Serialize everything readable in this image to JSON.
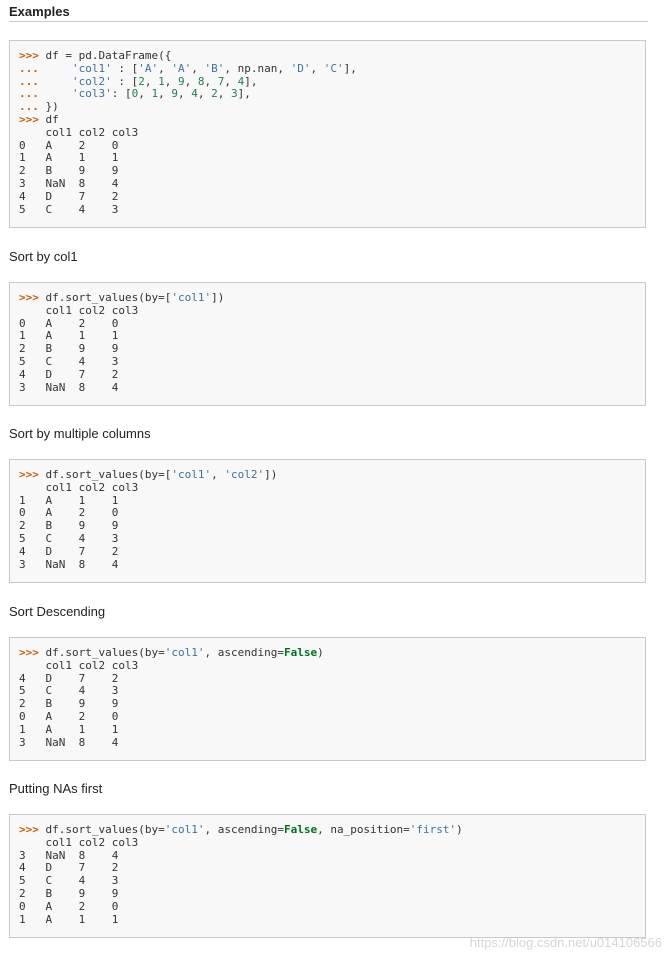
{
  "page": {
    "heading": "Examples",
    "watermark": "https://blog.csdn.net/u014106566"
  },
  "descriptions": [
    "Sort by col1",
    "Sort by multiple columns",
    "Sort Descending",
    "Putting NAs first"
  ],
  "blocks": [
    {
      "lines": [
        [
          {
            "t": ">>>",
            "c": "prompt"
          },
          {
            "t": " df = pd.DataFrame({"
          }
        ],
        [
          {
            "t": "...",
            "c": "prompt"
          },
          {
            "t": "     "
          },
          {
            "t": "'col1'",
            "c": "str"
          },
          {
            "t": " : ["
          },
          {
            "t": "'A'",
            "c": "str"
          },
          {
            "t": ", "
          },
          {
            "t": "'A'",
            "c": "str"
          },
          {
            "t": ", "
          },
          {
            "t": "'B'",
            "c": "str"
          },
          {
            "t": ", np.nan, "
          },
          {
            "t": "'D'",
            "c": "str"
          },
          {
            "t": ", "
          },
          {
            "t": "'C'",
            "c": "str"
          },
          {
            "t": "],"
          }
        ],
        [
          {
            "t": "...",
            "c": "prompt"
          },
          {
            "t": "     "
          },
          {
            "t": "'col2'",
            "c": "str"
          },
          {
            "t": " : ["
          },
          {
            "t": "2",
            "c": "num"
          },
          {
            "t": ", "
          },
          {
            "t": "1",
            "c": "num"
          },
          {
            "t": ", "
          },
          {
            "t": "9",
            "c": "num"
          },
          {
            "t": ", "
          },
          {
            "t": "8",
            "c": "num"
          },
          {
            "t": ", "
          },
          {
            "t": "7",
            "c": "num"
          },
          {
            "t": ", "
          },
          {
            "t": "4",
            "c": "num"
          },
          {
            "t": "],"
          }
        ],
        [
          {
            "t": "...",
            "c": "prompt"
          },
          {
            "t": "     "
          },
          {
            "t": "'col3'",
            "c": "str"
          },
          {
            "t": ": ["
          },
          {
            "t": "0",
            "c": "num"
          },
          {
            "t": ", "
          },
          {
            "t": "1",
            "c": "num"
          },
          {
            "t": ", "
          },
          {
            "t": "9",
            "c": "num"
          },
          {
            "t": ", "
          },
          {
            "t": "4",
            "c": "num"
          },
          {
            "t": ", "
          },
          {
            "t": "2",
            "c": "num"
          },
          {
            "t": ", "
          },
          {
            "t": "3",
            "c": "num"
          },
          {
            "t": "],"
          }
        ],
        [
          {
            "t": "...",
            "c": "prompt"
          },
          {
            "t": " })"
          }
        ],
        [
          {
            "t": ">>>",
            "c": "prompt"
          },
          {
            "t": " df"
          }
        ],
        [
          {
            "t": "    col1 col2 col3"
          }
        ],
        [
          {
            "t": "0   A    2    0"
          }
        ],
        [
          {
            "t": "1   A    1    1"
          }
        ],
        [
          {
            "t": "2   B    9    9"
          }
        ],
        [
          {
            "t": "3   NaN  8    4"
          }
        ],
        [
          {
            "t": "4   D    7    2"
          }
        ],
        [
          {
            "t": "5   C    4    3"
          }
        ]
      ]
    },
    {
      "lines": [
        [
          {
            "t": ">>>",
            "c": "prompt"
          },
          {
            "t": " df.sort_values(by=["
          },
          {
            "t": "'col1'",
            "c": "str"
          },
          {
            "t": "])"
          }
        ],
        [
          {
            "t": "    col1 col2 col3"
          }
        ],
        [
          {
            "t": "0   A    2    0"
          }
        ],
        [
          {
            "t": "1   A    1    1"
          }
        ],
        [
          {
            "t": "2   B    9    9"
          }
        ],
        [
          {
            "t": "5   C    4    3"
          }
        ],
        [
          {
            "t": "4   D    7    2"
          }
        ],
        [
          {
            "t": "3   NaN  8    4"
          }
        ]
      ]
    },
    {
      "lines": [
        [
          {
            "t": ">>>",
            "c": "prompt"
          },
          {
            "t": " df.sort_values(by=["
          },
          {
            "t": "'col1'",
            "c": "str"
          },
          {
            "t": ", "
          },
          {
            "t": "'col2'",
            "c": "str"
          },
          {
            "t": "])"
          }
        ],
        [
          {
            "t": "    col1 col2 col3"
          }
        ],
        [
          {
            "t": "1   A    1    1"
          }
        ],
        [
          {
            "t": "0   A    2    0"
          }
        ],
        [
          {
            "t": "2   B    9    9"
          }
        ],
        [
          {
            "t": "5   C    4    3"
          }
        ],
        [
          {
            "t": "4   D    7    2"
          }
        ],
        [
          {
            "t": "3   NaN  8    4"
          }
        ]
      ]
    },
    {
      "lines": [
        [
          {
            "t": ">>>",
            "c": "prompt"
          },
          {
            "t": " df.sort_values(by="
          },
          {
            "t": "'col1'",
            "c": "str"
          },
          {
            "t": ", ascending="
          },
          {
            "t": "False",
            "c": "kw"
          },
          {
            "t": ")"
          }
        ],
        [
          {
            "t": "    col1 col2 col3"
          }
        ],
        [
          {
            "t": "4   D    7    2"
          }
        ],
        [
          {
            "t": "5   C    4    3"
          }
        ],
        [
          {
            "t": "2   B    9    9"
          }
        ],
        [
          {
            "t": "0   A    2    0"
          }
        ],
        [
          {
            "t": "1   A    1    1"
          }
        ],
        [
          {
            "t": "3   NaN  8    4"
          }
        ]
      ]
    },
    {
      "lines": [
        [
          {
            "t": ">>>",
            "c": "prompt"
          },
          {
            "t": " df.sort_values(by="
          },
          {
            "t": "'col1'",
            "c": "str"
          },
          {
            "t": ", ascending="
          },
          {
            "t": "False",
            "c": "kw"
          },
          {
            "t": ", na_position="
          },
          {
            "t": "'first'",
            "c": "str"
          },
          {
            "t": ")"
          }
        ],
        [
          {
            "t": "    col1 col2 col3"
          }
        ],
        [
          {
            "t": "3   NaN  8    4"
          }
        ],
        [
          {
            "t": "4   D    7    2"
          }
        ],
        [
          {
            "t": "5   C    4    3"
          }
        ],
        [
          {
            "t": "2   B    9    9"
          }
        ],
        [
          {
            "t": "0   A    2    0"
          }
        ],
        [
          {
            "t": "1   A    1    1"
          }
        ]
      ]
    }
  ]
}
